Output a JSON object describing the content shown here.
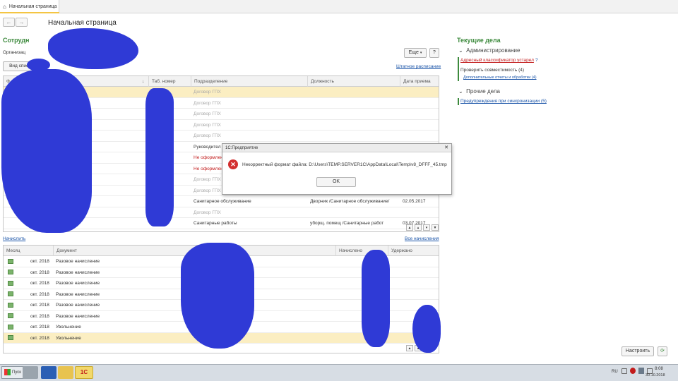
{
  "tabs": {
    "home_label": "Начальная страница"
  },
  "page_title": "Начальная страница",
  "nav": {
    "back": "←",
    "forward": "→"
  },
  "employees": {
    "title": "Сотрудн",
    "org_label": "Организац",
    "more_button": "Еще",
    "help_button": "?",
    "view_button": "Вид списка",
    "staff_link": "Штатное расписание",
    "columns": [
      "Ф",
      "Таб. номер",
      "Подразделение",
      "Должность",
      "Дата приема"
    ],
    "rows": [
      {
        "dept": "Договор ГПХ",
        "pos": "",
        "date": "",
        "style": "gray",
        "selected": true
      },
      {
        "dept": "Договор ГПХ",
        "pos": "",
        "date": "",
        "style": "gray",
        "selected": false
      },
      {
        "dept": "Договор ГПХ",
        "pos": "",
        "date": "",
        "style": "gray",
        "selected": false
      },
      {
        "dept": "Договор ГПХ",
        "pos": "",
        "date": "",
        "style": "gray",
        "selected": false
      },
      {
        "dept": "Договор ГПХ",
        "pos": "",
        "date": "",
        "style": "gray",
        "selected": false
      },
      {
        "dept": "Руководител",
        "pos": "",
        "date": "",
        "style": "normal",
        "selected": false
      },
      {
        "dept": "Не оформлен",
        "pos": "",
        "date": "",
        "style": "red",
        "selected": false
      },
      {
        "dept": "Не оформлен",
        "pos": "",
        "date": "",
        "style": "red",
        "selected": false
      },
      {
        "dept": "Договор ГПХ",
        "pos": "",
        "date": "",
        "style": "gray",
        "selected": false
      },
      {
        "dept": "Договор ГПХ",
        "pos": "",
        "date": "",
        "style": "gray",
        "selected": false
      },
      {
        "dept": "Санитарное обслуживание",
        "pos": "Дворник /Санитарное обслуживание/",
        "date": "02.05.2017",
        "style": "normal",
        "selected": false
      },
      {
        "dept": "Договор ГПХ",
        "pos": "",
        "date": "",
        "style": "gray",
        "selected": false
      },
      {
        "dept": "Санитарные работы",
        "pos": "уборщ. помещ /Санитарные работ",
        "date": "03.07.2017",
        "style": "normal",
        "selected": false
      }
    ]
  },
  "accruals": {
    "link": "Начислить",
    "all_link": "Все начисления",
    "columns": [
      "Месяц",
      "Документ",
      "Начислено",
      "Удержано"
    ],
    "rows": [
      {
        "month": "окт. 2018",
        "doc": "Разовое начисление",
        "selected": false
      },
      {
        "month": "окт. 2018",
        "doc": "Разовое начисление",
        "selected": false
      },
      {
        "month": "окт. 2018",
        "doc": "Разовое начисление",
        "selected": false
      },
      {
        "month": "окт. 2018",
        "doc": "Разовое начисление",
        "selected": false
      },
      {
        "month": "окт. 2018",
        "doc": "Разовое начисление",
        "selected": false
      },
      {
        "month": "окт. 2018",
        "doc": "Разовое начисление",
        "selected": false
      },
      {
        "month": "окт. 2018",
        "doc": "Увольнение",
        "selected": false
      },
      {
        "month": "окт. 2018",
        "doc": "Увольнение",
        "selected": true
      }
    ]
  },
  "current": {
    "title": "Текущие дела",
    "admin_group": "Администрирование",
    "address_link": "Адресный классификатор устарел",
    "compat_text": "Проверить совместимость (4)",
    "extra_link": "Дополнительные отчеты и обработки (4)",
    "other_group": "Прочие дела",
    "sync_link": "Предупреждения при синхронизации (5)",
    "setup_button": "Настроить",
    "refresh_icon": "refresh-icon"
  },
  "dialog": {
    "title": "1С:Предприятие",
    "message": "Некорректный формат файла: D:\\Users\\TEMP.SERVER1C\\AppData\\Local\\Temp\\v8_DFFF_45.tmp",
    "ok": "OK",
    "close": "✕"
  },
  "taskbar": {
    "start": "Пуск",
    "lang": "RU",
    "time": "8:08",
    "date": "30.10.2018"
  },
  "colors": {
    "section_green": "#3d8a3d",
    "link_blue": "#1a54a8",
    "error_red": "#d32f2f",
    "selection": "#fbeec2",
    "scribble": "#2f3ad6"
  }
}
